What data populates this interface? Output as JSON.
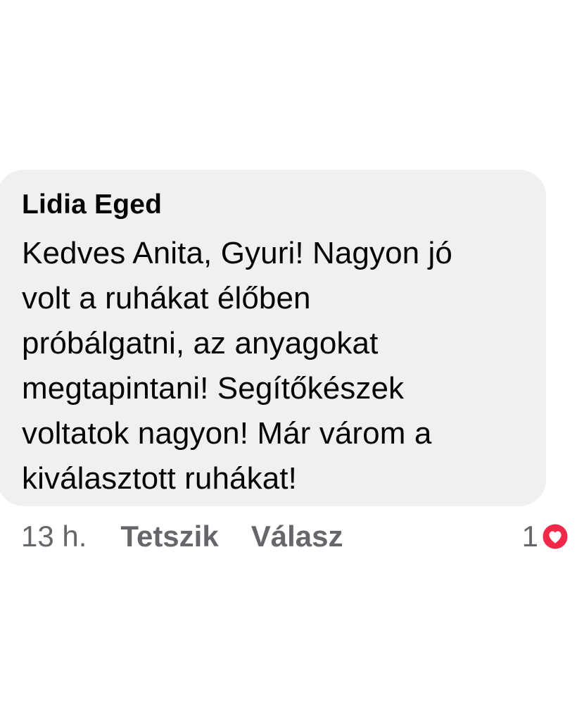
{
  "comment": {
    "author": "Lidia Eged",
    "text_lines": [
      "Kedves Anita, Gyuri! Nagyon jó",
      "volt a ruhákat élőben",
      "próbálgatni, az anyagokat",
      "megtapintani! Segítőkészek",
      "voltatok nagyon! Már várom a",
      "kiválasztott ruhákat!"
    ]
  },
  "actions": {
    "timestamp": "13 h.",
    "like_label": "Tetszik",
    "reply_label": "Válasz"
  },
  "reactions": {
    "count": "1",
    "icon": "heart-icon",
    "color": "#f0284a"
  }
}
